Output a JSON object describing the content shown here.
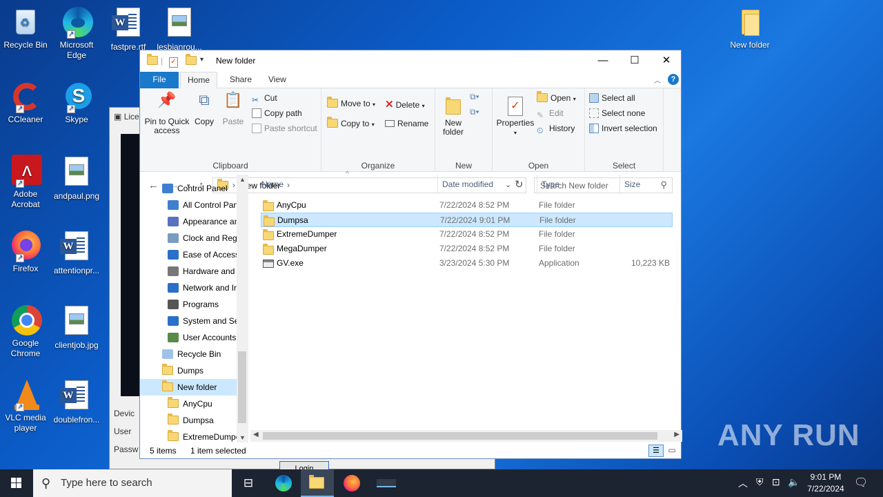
{
  "desktop": {
    "icons": [
      {
        "label": "Recycle Bin"
      },
      {
        "label": "Microsoft Edge"
      },
      {
        "label": "fastpre.rtf"
      },
      {
        "label": "lesbianrou..."
      },
      {
        "label": "New folder"
      },
      {
        "label": "CCleaner"
      },
      {
        "label": "Skype"
      },
      {
        "label": "Adobe Acrobat"
      },
      {
        "label": "andpaul.png"
      },
      {
        "label": "Firefox"
      },
      {
        "label": "attentionpr..."
      },
      {
        "label": "Google Chrome"
      },
      {
        "label": "clientjob.jpg"
      },
      {
        "label": "VLC media player"
      },
      {
        "label": "doublefron..."
      }
    ],
    "watermark": "ANY RUN"
  },
  "background_window": {
    "title": "Lice",
    "labels": [
      "Devic",
      "User",
      "Passw"
    ],
    "login": "Login"
  },
  "explorer": {
    "title": "New folder",
    "window_buttons": {
      "minimize": "—",
      "maximize": "☐",
      "close": "✕"
    },
    "tabs": [
      "File",
      "Home",
      "Share",
      "View"
    ],
    "ribbon": {
      "clipboard": {
        "label": "Clipboard",
        "pin": "Pin to Quick access",
        "copy": "Copy",
        "paste": "Paste",
        "cut": "Cut",
        "copy_path": "Copy path",
        "paste_shortcut": "Paste shortcut"
      },
      "organize": {
        "label": "Organize",
        "move_to": "Move to",
        "copy_to": "Copy to",
        "delete": "Delete",
        "rename": "Rename"
      },
      "new": {
        "label": "New",
        "new_folder": "New folder"
      },
      "open": {
        "label": "Open",
        "properties": "Properties",
        "open": "Open",
        "edit": "Edit",
        "history": "History"
      },
      "select": {
        "label": "Select",
        "select_all": "Select all",
        "select_none": "Select none",
        "invert": "Invert selection"
      }
    },
    "address": {
      "path": "New folder",
      "search_placeholder": "Search New folder"
    },
    "nav": [
      {
        "label": "Control Panel",
        "indent": 1
      },
      {
        "label": "All Control Panel Items",
        "indent": 2
      },
      {
        "label": "Appearance and Personalization",
        "indent": 2
      },
      {
        "label": "Clock and Region",
        "indent": 2
      },
      {
        "label": "Ease of Access",
        "indent": 2
      },
      {
        "label": "Hardware and Sound",
        "indent": 2
      },
      {
        "label": "Network and Internet",
        "indent": 2
      },
      {
        "label": "Programs",
        "indent": 2
      },
      {
        "label": "System and Security",
        "indent": 2
      },
      {
        "label": "User Accounts",
        "indent": 2
      },
      {
        "label": "Recycle Bin",
        "indent": 1
      },
      {
        "label": "Dumps",
        "indent": 1
      },
      {
        "label": "New folder",
        "indent": 1,
        "selected": true
      },
      {
        "label": "AnyCpu",
        "indent": 2
      },
      {
        "label": "Dumpsa",
        "indent": 2
      },
      {
        "label": "ExtremeDumper",
        "indent": 2
      }
    ],
    "columns": [
      "Name",
      "Date modified",
      "Type",
      "Size"
    ],
    "files": [
      {
        "name": "AnyCpu",
        "date": "7/22/2024 8:52 PM",
        "type": "File folder",
        "size": "",
        "kind": "folder"
      },
      {
        "name": "Dumpsa",
        "date": "7/22/2024 9:01 PM",
        "type": "File folder",
        "size": "",
        "kind": "folder",
        "selected": true
      },
      {
        "name": "ExtremeDumper",
        "date": "7/22/2024 8:52 PM",
        "type": "File folder",
        "size": "",
        "kind": "folder"
      },
      {
        "name": "MegaDumper",
        "date": "7/22/2024 8:52 PM",
        "type": "File folder",
        "size": "",
        "kind": "folder"
      },
      {
        "name": "GV.exe",
        "date": "3/23/2024 5:30 PM",
        "type": "Application",
        "size": "10,223 KB",
        "kind": "app"
      }
    ],
    "status": {
      "count": "5 items",
      "selection": "1 item selected"
    }
  },
  "taskbar": {
    "search_placeholder": "Type here to search",
    "time": "9:01 PM",
    "date": "7/22/2024"
  },
  "colors": {
    "accent": "#1979ca",
    "selection": "#cce8ff",
    "taskbar": "#1c2331"
  }
}
